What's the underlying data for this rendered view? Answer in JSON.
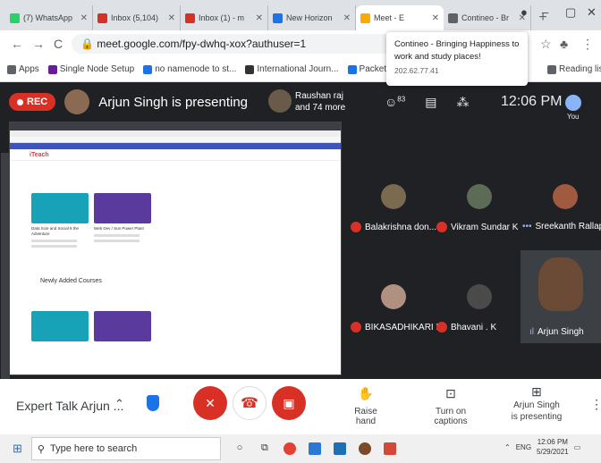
{
  "browser": {
    "tabs": [
      {
        "title": "(7) WhatsApp",
        "color": "#25d366"
      },
      {
        "title": "Inbox (5,104)",
        "color": "#d93025"
      },
      {
        "title": "Inbox (1) - m",
        "color": "#d93025"
      },
      {
        "title": "New Horizon",
        "color": "#1a73e8"
      },
      {
        "title": "Meet - E",
        "color": "#f9ab00"
      },
      {
        "title": "Contineo - Br",
        "color": "#5f6368"
      }
    ],
    "new_tab": "+",
    "url": "meet.google.com/fpy-dwhq-xox?authuser=1",
    "bookmarks": [
      {
        "label": "Apps",
        "color": "#5f6368"
      },
      {
        "label": "Single Node Setup",
        "color": "#6a1b9a"
      },
      {
        "label": "no namenode to st...",
        "color": "#1a73e8"
      },
      {
        "label": "International Journ...",
        "color": "#333333"
      },
      {
        "label": "Packet Tracer 6 Acti...",
        "color": "#1a73e8"
      },
      {
        "label": "Reading list",
        "color": "#5f6368"
      }
    ],
    "popup": {
      "title": "Contineo - Bringing Happiness to work and study places!",
      "ip": "202.62.77.41"
    }
  },
  "meet": {
    "rec_label": "REC",
    "presenter_text": "Arjun Singh is presenting",
    "others": {
      "name": "Raushan raj",
      "more": "and 74 more"
    },
    "people_count": "83",
    "time": "12:06 PM",
    "you_label": "You",
    "shared_screen": {
      "logo": "iTeach",
      "section_title": "Newly Added Courses",
      "cards": [
        {
          "caption": "Data Scie and Social 8 the Adventure",
          "color": "#17a2b8"
        },
        {
          "caption": "Web Dev / Sun Power Plant",
          "color": "#5b3a9e"
        }
      ]
    },
    "participants": [
      {
        "name": "Balakrishna don...",
        "muted": true,
        "color": "#7a6a50"
      },
      {
        "name": "Vikram Sundar K",
        "muted": true,
        "color": "#5b6b55"
      },
      {
        "name": "Sreekanth Rallap...",
        "muted": false,
        "color": "#a05a40"
      },
      {
        "name": "BIKASADHIKARI B",
        "muted": true,
        "color": "#b09080"
      },
      {
        "name": "Bhavani . K",
        "muted": true,
        "color": "#4a4a4a"
      }
    ],
    "speaker_tile": {
      "name": "Arjun Singh"
    }
  },
  "controls": {
    "meeting_name": "Expert Talk Arjun ...",
    "raise_hand": "Raise hand",
    "captions": "Turn on captions",
    "presenting": "Arjun Singh is presenting"
  },
  "taskbar": {
    "search_placeholder": "Type here to search",
    "lang": "ENG",
    "time": "12:06 PM",
    "date": "5/29/2021"
  }
}
